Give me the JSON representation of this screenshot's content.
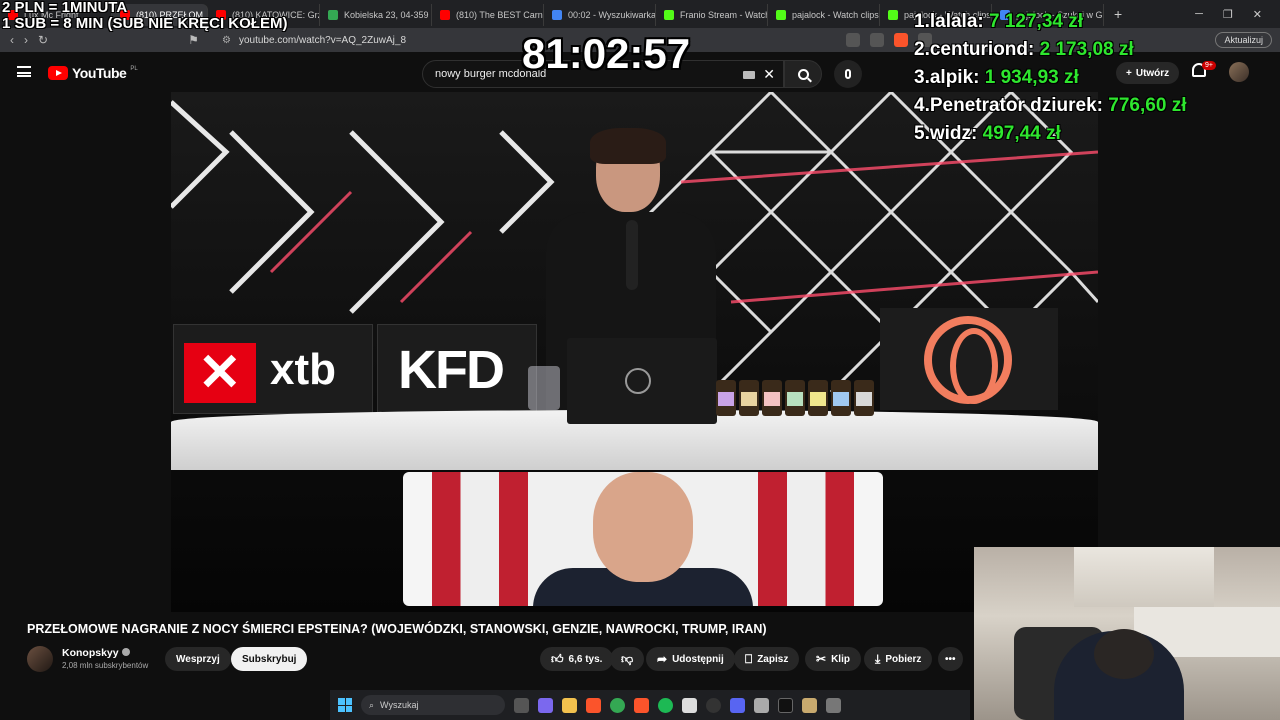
{
  "browser": {
    "tabs": [
      {
        "label": "Lux Mc Fright",
        "color": "#ff0000"
      },
      {
        "label": "(810) PRZEŁOM",
        "color": "#ff0000",
        "active": true
      },
      {
        "label": "(810) KATOWICE: Grze",
        "color": "#ff0000"
      },
      {
        "label": "Kobielska 23, 04-359 W",
        "color": "#34a853"
      },
      {
        "label": "(810) The BEST Carnita",
        "color": "#ff0000"
      },
      {
        "label": "00:02 - Wyszukiwarka",
        "color": "#4285f4"
      },
      {
        "label": "Franio Stream - Watch",
        "color": "#53fc18"
      },
      {
        "label": "pajalock - Watch clips",
        "color": "#53fc18"
      },
      {
        "label": "pajalock - Watch clips",
        "color": "#53fc18"
      },
      {
        "label": "pajalock - Szukaj w G",
        "color": "#4285f4"
      }
    ],
    "active_tab_close": "×",
    "new_tab": "+",
    "url": "youtube.com/watch?v=AQ_2ZuwAj_8",
    "update_label": "Aktualizuj"
  },
  "youtube": {
    "logo_text": "YouTube",
    "country": "PL",
    "search_value": "nowy burger mcdonald",
    "create_label": "Utwórz",
    "notif_count": "9+"
  },
  "video": {
    "xtb_text": "xtb",
    "kfd_text": "KFD"
  },
  "overlay": {
    "rule_1": "2 PLN = 1MINUTA",
    "rule_2": "1 SUB = 8 MIN (SUB NIE KRĘCI KOŁEM)",
    "timer": "81:02:57",
    "leaderboard": [
      {
        "rank": "1.",
        "name": "lalala:",
        "amount": "7 127,34 zł"
      },
      {
        "rank": "2.",
        "name": "centuriond:",
        "amount": "2 173,08 zł"
      },
      {
        "rank": "3.",
        "name": "alpik:",
        "amount": "1 934,93 zł"
      },
      {
        "rank": "4.",
        "name": "Penetrator dziurek:",
        "amount": "776,60 zł"
      },
      {
        "rank": "5.",
        "name": "widz:",
        "amount": "497,44 zł"
      }
    ]
  },
  "watch": {
    "title": "PRZEŁOMOWE NAGRANIE Z NOCY ŚMIERCI EPSTEINA? (WOJEWÓDZKI, STANOWSKI, GENZIE, NAWROCKI, TRUMP, IRAN)",
    "channel": "Konopskyy",
    "subscribers": "2,08 mln subskrybentów",
    "support_label": "Wesprzyj",
    "subscribe_label": "Subskrybuj",
    "likes": "6,6 tys.",
    "share_label": "Udostępnij",
    "save_label": "Zapisz",
    "clip_label": "Klip",
    "download_label": "Pobierz",
    "more_label": "•••"
  },
  "taskbar": {
    "search_placeholder": "Wyszukaj"
  }
}
